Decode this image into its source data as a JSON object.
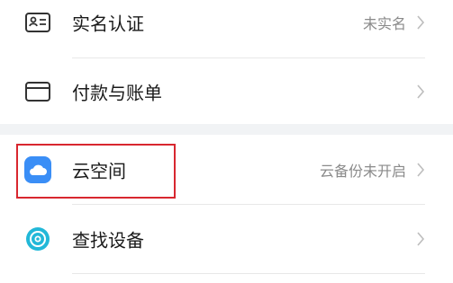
{
  "settings": {
    "rows": [
      {
        "label": "实名认证",
        "value": "未实名",
        "icon": "id-card-icon"
      },
      {
        "label": "付款与账单",
        "value": "",
        "icon": "card-icon"
      },
      {
        "label": "云空间",
        "value": "云备份未开启",
        "icon": "cloud-icon"
      },
      {
        "label": "查找设备",
        "value": "",
        "icon": "find-device-icon"
      }
    ]
  },
  "colors": {
    "highlight": "#d8272f",
    "cloud_blue": "#3a8ef6",
    "find_teal": "#22b8d8",
    "label_text": "#1a1a1a",
    "value_text": "#8a8a8a"
  }
}
